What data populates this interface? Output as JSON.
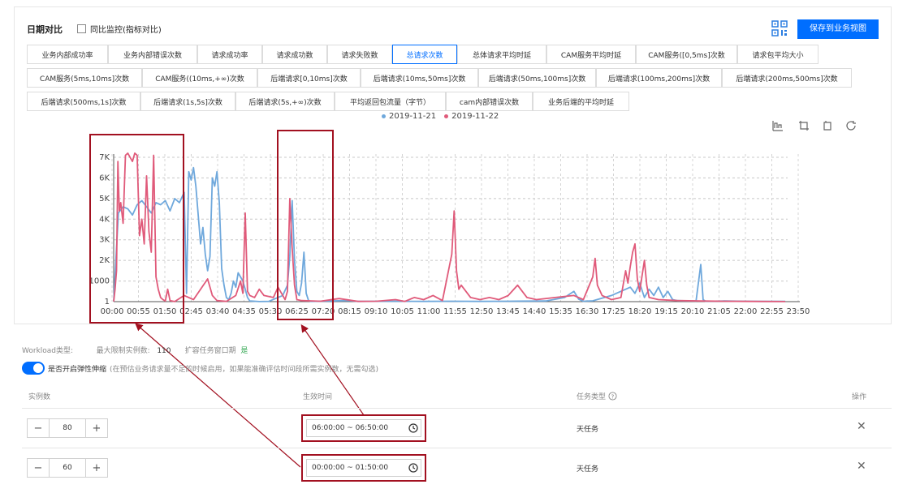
{
  "header": {
    "title": "日期对比",
    "compare_label": "同比监控(指标对比)",
    "save_label": "保存到业务视图"
  },
  "metric_tabs": [
    "业务内部成功率",
    "业务内部错误次数",
    "请求成功率",
    "请求成功数",
    "请求失败数",
    "总请求次数",
    "总体请求平均时延",
    "CAM服务平均时延",
    "CAM服务([0,5ms]次数",
    "请求包平均大小",
    "CAM服务(5ms,10ms]次数",
    "CAM服务((10ms,+∞)次数",
    "后端请求[0,10ms]次数",
    "后端请求(10ms,50ms]次数",
    "后端请求(50ms,100ms]次数",
    "后端请求(100ms,200ms]次数",
    "后端请求(200ms,500ms]次数",
    "后端请求(500ms,1s]次数",
    "后端请求(1s,5s]次数",
    "后端请求(5s,+∞)次数",
    "平均返回包流量（字节）",
    "cam内部错误次数",
    "业务后端的平均时延"
  ],
  "active_tab": "总请求次数",
  "chart_data": {
    "type": "line",
    "y_ticks": [
      "1",
      "1000",
      "2K",
      "3K",
      "4K",
      "5K",
      "6K",
      "7K"
    ],
    "x_ticks": [
      "00:00",
      "00:55",
      "01:50",
      "02:45",
      "03:40",
      "04:35",
      "05:30",
      "06:25",
      "07:20",
      "08:15",
      "09:10",
      "10:05",
      "11:00",
      "11:55",
      "12:50",
      "13:45",
      "14:40",
      "15:35",
      "16:30",
      "17:25",
      "18:20",
      "19:15",
      "20:10",
      "21:05",
      "22:00",
      "22:55",
      "23:50"
    ],
    "ylim": [
      0,
      7200
    ],
    "xlim": [
      0,
      1435
    ],
    "series": [
      {
        "name": "2019-11-21",
        "color": "#6fa8dc",
        "points": [
          [
            0,
            5
          ],
          [
            10,
            4300
          ],
          [
            20,
            4600
          ],
          [
            30,
            4500
          ],
          [
            40,
            4200
          ],
          [
            50,
            4700
          ],
          [
            60,
            4900
          ],
          [
            70,
            4600
          ],
          [
            80,
            4300
          ],
          [
            90,
            4800
          ],
          [
            100,
            4700
          ],
          [
            110,
            4900
          ],
          [
            120,
            4400
          ],
          [
            130,
            5000
          ],
          [
            140,
            4800
          ],
          [
            150,
            5300
          ],
          [
            155,
            400
          ],
          [
            160,
            6300
          ],
          [
            165,
            5900
          ],
          [
            170,
            6500
          ],
          [
            175,
            5600
          ],
          [
            180,
            4200
          ],
          [
            185,
            2800
          ],
          [
            190,
            3600
          ],
          [
            195,
            2300
          ],
          [
            200,
            1500
          ],
          [
            205,
            2200
          ],
          [
            210,
            6000
          ],
          [
            215,
            5600
          ],
          [
            220,
            6300
          ],
          [
            225,
            4800
          ],
          [
            230,
            1600
          ],
          [
            235,
            800
          ],
          [
            240,
            200
          ],
          [
            245,
            100
          ],
          [
            250,
            400
          ],
          [
            255,
            1000
          ],
          [
            260,
            700
          ],
          [
            265,
            1400
          ],
          [
            270,
            1200
          ],
          [
            275,
            1000
          ],
          [
            280,
            600
          ],
          [
            285,
            200
          ],
          [
            290,
            30
          ],
          [
            310,
            5
          ],
          [
            330,
            10
          ],
          [
            360,
            300
          ],
          [
            370,
            800
          ],
          [
            375,
            2200
          ],
          [
            380,
            4900
          ],
          [
            385,
            2000
          ],
          [
            390,
            500
          ],
          [
            395,
            300
          ],
          [
            400,
            900
          ],
          [
            405,
            2400
          ],
          [
            410,
            400
          ],
          [
            415,
            50
          ],
          [
            420,
            10
          ],
          [
            500,
            50
          ],
          [
            520,
            10
          ],
          [
            600,
            20
          ],
          [
            660,
            10
          ],
          [
            720,
            20
          ],
          [
            780,
            10
          ],
          [
            840,
            20
          ],
          [
            920,
            30
          ],
          [
            960,
            200
          ],
          [
            980,
            500
          ],
          [
            990,
            120
          ],
          [
            1000,
            20
          ],
          [
            1020,
            40
          ],
          [
            1060,
            300
          ],
          [
            1100,
            700
          ],
          [
            1110,
            400
          ],
          [
            1120,
            900
          ],
          [
            1130,
            200
          ],
          [
            1140,
            600
          ],
          [
            1150,
            300
          ],
          [
            1160,
            700
          ],
          [
            1170,
            200
          ],
          [
            1180,
            500
          ],
          [
            1190,
            100
          ],
          [
            1200,
            50
          ],
          [
            1220,
            40
          ],
          [
            1240,
            30
          ],
          [
            1250,
            1800
          ],
          [
            1255,
            100
          ],
          [
            1260,
            20
          ],
          [
            1300,
            30
          ],
          [
            1340,
            20
          ],
          [
            1380,
            10
          ],
          [
            1430,
            10
          ]
        ]
      },
      {
        "name": "2019-11-22",
        "color": "#e05a7a",
        "points": [
          [
            0,
            5
          ],
          [
            3,
            600
          ],
          [
            6,
            1500
          ],
          [
            9,
            6800
          ],
          [
            12,
            4400
          ],
          [
            15,
            4800
          ],
          [
            20,
            3800
          ],
          [
            25,
            7100
          ],
          [
            30,
            7200
          ],
          [
            35,
            7000
          ],
          [
            40,
            6800
          ],
          [
            45,
            7200
          ],
          [
            50,
            7100
          ],
          [
            55,
            3200
          ],
          [
            60,
            4000
          ],
          [
            65,
            2800
          ],
          [
            70,
            6100
          ],
          [
            75,
            3400
          ],
          [
            80,
            2400
          ],
          [
            85,
            7100
          ],
          [
            90,
            1200
          ],
          [
            95,
            600
          ],
          [
            100,
            200
          ],
          [
            105,
            100
          ],
          [
            110,
            30
          ],
          [
            115,
            600
          ],
          [
            120,
            50
          ],
          [
            130,
            5
          ],
          [
            150,
            300
          ],
          [
            170,
            100
          ],
          [
            200,
            1100
          ],
          [
            210,
            300
          ],
          [
            220,
            50
          ],
          [
            240,
            10
          ],
          [
            260,
            300
          ],
          [
            270,
            1000
          ],
          [
            275,
            400
          ],
          [
            280,
            4300
          ],
          [
            285,
            500
          ],
          [
            290,
            300
          ],
          [
            300,
            200
          ],
          [
            310,
            600
          ],
          [
            320,
            300
          ],
          [
            340,
            200
          ],
          [
            350,
            700
          ],
          [
            360,
            300
          ],
          [
            365,
            100
          ],
          [
            370,
            500
          ],
          [
            375,
            5000
          ],
          [
            380,
            2600
          ],
          [
            385,
            800
          ],
          [
            390,
            100
          ],
          [
            400,
            50
          ],
          [
            440,
            20
          ],
          [
            480,
            150
          ],
          [
            520,
            10
          ],
          [
            560,
            20
          ],
          [
            600,
            100
          ],
          [
            620,
            10
          ],
          [
            640,
            200
          ],
          [
            660,
            100
          ],
          [
            680,
            300
          ],
          [
            700,
            50
          ],
          [
            720,
            2300
          ],
          [
            725,
            4400
          ],
          [
            730,
            1500
          ],
          [
            735,
            600
          ],
          [
            740,
            800
          ],
          [
            750,
            500
          ],
          [
            760,
            200
          ],
          [
            780,
            100
          ],
          [
            800,
            200
          ],
          [
            820,
            100
          ],
          [
            840,
            300
          ],
          [
            860,
            800
          ],
          [
            880,
            200
          ],
          [
            900,
            100
          ],
          [
            940,
            200
          ],
          [
            980,
            300
          ],
          [
            1000,
            100
          ],
          [
            1020,
            1200
          ],
          [
            1025,
            2100
          ],
          [
            1030,
            800
          ],
          [
            1040,
            300
          ],
          [
            1060,
            100
          ],
          [
            1080,
            200
          ],
          [
            1090,
            1500
          ],
          [
            1095,
            900
          ],
          [
            1100,
            1700
          ],
          [
            1105,
            2400
          ],
          [
            1110,
            2800
          ],
          [
            1115,
            1100
          ],
          [
            1120,
            500
          ],
          [
            1130,
            2000
          ],
          [
            1135,
            800
          ],
          [
            1140,
            200
          ],
          [
            1160,
            100
          ],
          [
            1200,
            50
          ],
          [
            1250,
            30
          ],
          [
            1300,
            20
          ],
          [
            1350,
            10
          ],
          [
            1430,
            5
          ]
        ]
      }
    ]
  },
  "workload": {
    "type_label": "Workload类型:",
    "max_label": "最大限制实例数:",
    "max_value": "110",
    "window_label": "扩容任务窗口期",
    "window_value": "是",
    "elastic_label": "是否开启弹性伸缩",
    "elastic_note": "(在预估业务请求量不足的时候启用，如果能准确评估时间段所需实例数，无需勾选)"
  },
  "table": {
    "col_instances": "实例数",
    "col_time": "生效时间",
    "col_type": "任务类型",
    "col_ops": "操作",
    "rows": [
      {
        "instances": "80",
        "time": "06:00:00 ~ 06:50:00",
        "type": "天任务"
      },
      {
        "instances": "60",
        "time": "00:00:00 ~ 01:50:00",
        "type": "天任务"
      }
    ]
  },
  "icons": [
    "qr-code-icon",
    "chart-area-icon",
    "crop-icon",
    "restore-icon",
    "refresh-icon",
    "help-icon",
    "clock-icon",
    "close-icon"
  ]
}
